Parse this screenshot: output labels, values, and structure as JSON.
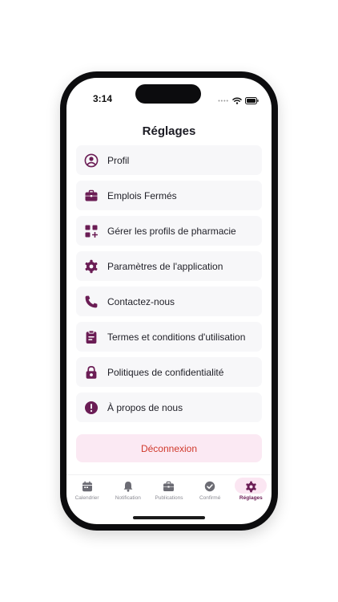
{
  "status_bar": {
    "time": "3:14"
  },
  "header": {
    "title": "Réglages"
  },
  "colors": {
    "accent": "#6b1d55",
    "danger": "#d0392b",
    "item_background": "#f7f7f9",
    "logout_background": "#fbe9f3"
  },
  "menu": {
    "items": [
      {
        "label": "Profil",
        "icon": "user-circle-icon"
      },
      {
        "label": "Emplois Fermés",
        "icon": "briefcase-icon"
      },
      {
        "label": "Gérer les profils de pharmacie",
        "icon": "grid-add-icon"
      },
      {
        "label": "Paramètres de l'application",
        "icon": "gear-icon"
      },
      {
        "label": "Contactez-nous",
        "icon": "phone-icon"
      },
      {
        "label": "Termes et conditions d'utilisation",
        "icon": "clipboard-icon"
      },
      {
        "label": "Politiques de confidentialité",
        "icon": "lock-icon"
      },
      {
        "label": "À propos de nous",
        "icon": "info-exclamation-icon"
      }
    ]
  },
  "logout": {
    "label": "Déconnexion"
  },
  "tabbar": {
    "active": "Réglages",
    "items": [
      {
        "label": "Calendrier",
        "icon": "calendar-icon"
      },
      {
        "label": "Notification",
        "icon": "bell-icon"
      },
      {
        "label": "Publications",
        "icon": "briefcase-icon"
      },
      {
        "label": "Confirmé",
        "icon": "check-circle-icon"
      },
      {
        "label": "Réglages",
        "icon": "gear-icon"
      }
    ]
  }
}
